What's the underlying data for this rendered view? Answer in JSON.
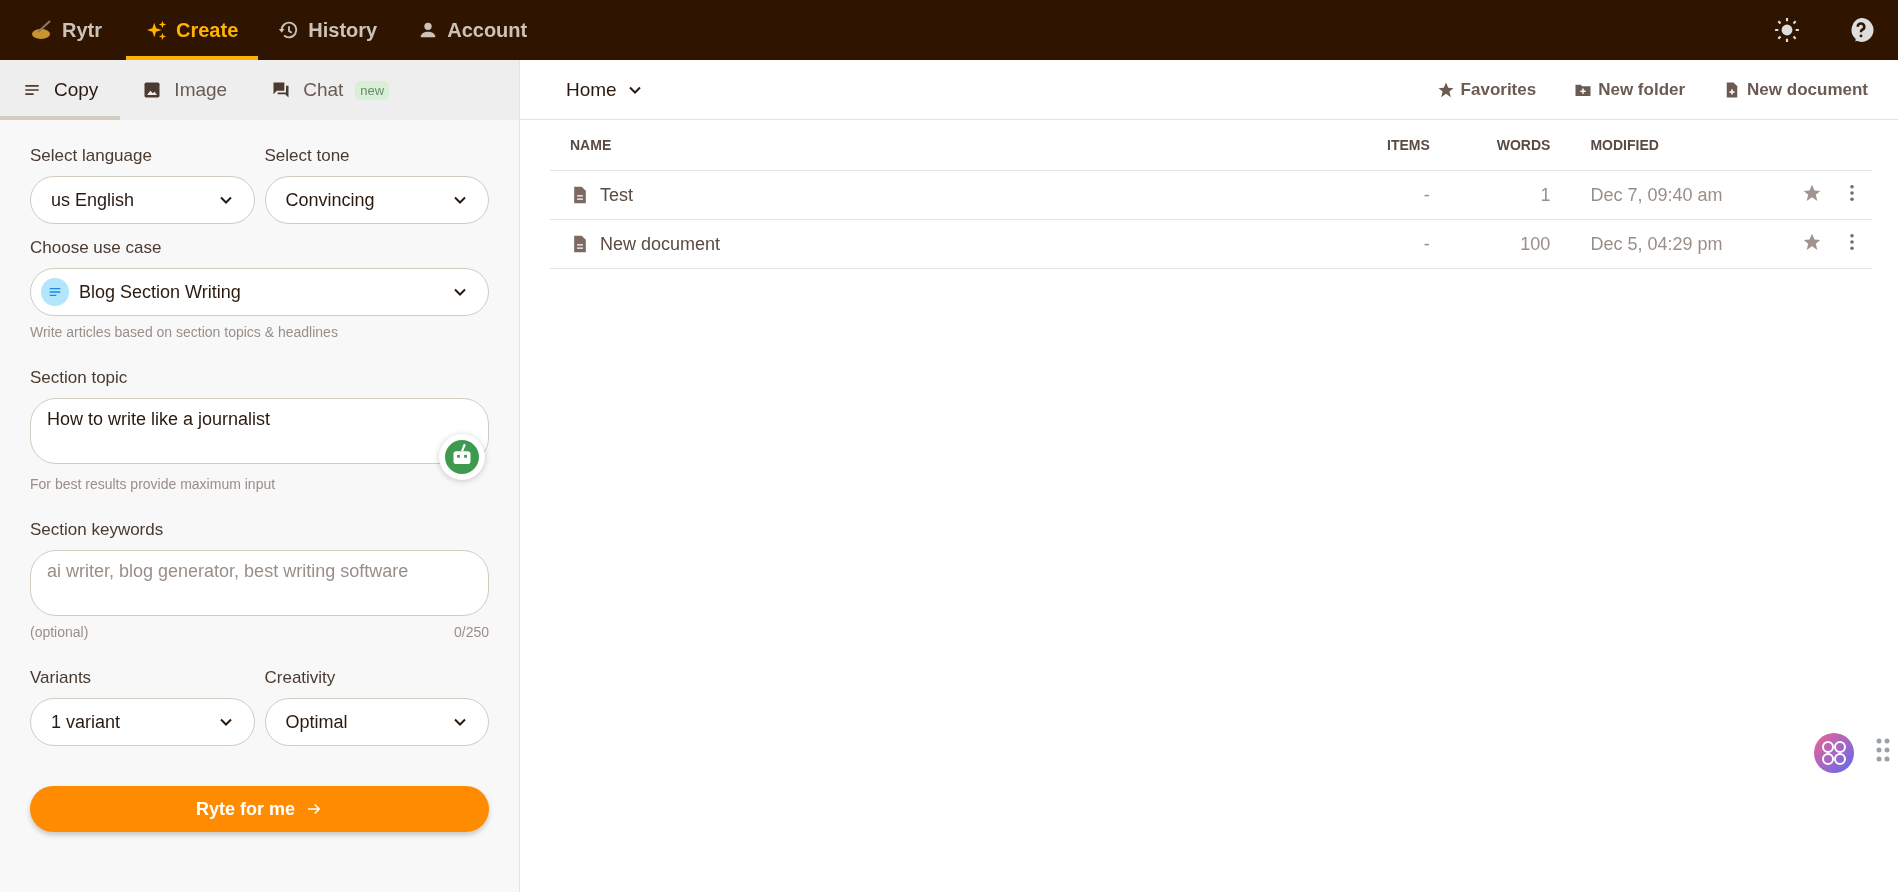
{
  "topbar": {
    "brand": "Rytr",
    "nav": [
      {
        "label": "Create",
        "selected": true,
        "kind": "sparkle"
      },
      {
        "label": "History",
        "selected": false,
        "kind": "history"
      },
      {
        "label": "Account",
        "selected": false,
        "kind": "person"
      }
    ]
  },
  "tabs": [
    {
      "label": "Copy",
      "selected": true,
      "kind": "lines"
    },
    {
      "label": "Image",
      "selected": false,
      "kind": "image"
    },
    {
      "label": "Chat",
      "selected": false,
      "kind": "chat",
      "badge": "new"
    }
  ],
  "form": {
    "language": {
      "label": "Select language",
      "value": "us English"
    },
    "tone": {
      "label": "Select tone",
      "value": "Convincing"
    },
    "use_case": {
      "label": "Choose use case",
      "value": "Blog Section Writing",
      "hint": "Write articles based on section topics & headlines"
    },
    "topic": {
      "label": "Section topic",
      "value": "How to write like a journalist",
      "hint": "For best results provide maximum input"
    },
    "keywords": {
      "label": "Section keywords",
      "placeholder": "ai writer, blog generator, best writing software",
      "hint": "(optional)",
      "counter": "0/250"
    },
    "variants": {
      "label": "Variants",
      "value": "1 variant"
    },
    "creativity": {
      "label": "Creativity",
      "value": "Optimal"
    },
    "submit": "Ryte for me"
  },
  "header": {
    "folder": "Home",
    "actions": [
      {
        "label": "Favorites",
        "kind": "star"
      },
      {
        "label": "New folder",
        "kind": "folder"
      },
      {
        "label": "New document",
        "kind": "doc"
      }
    ]
  },
  "table": {
    "columns": [
      "NAME",
      "ITEMS",
      "WORDS",
      "MODIFIED"
    ],
    "rows": [
      {
        "name": "Test",
        "items": "-",
        "words": "1",
        "modified": "Dec 7, 09:40 am"
      },
      {
        "name": "New document",
        "items": "-",
        "words": "100",
        "modified": "Dec 5, 04:29 pm"
      }
    ]
  }
}
